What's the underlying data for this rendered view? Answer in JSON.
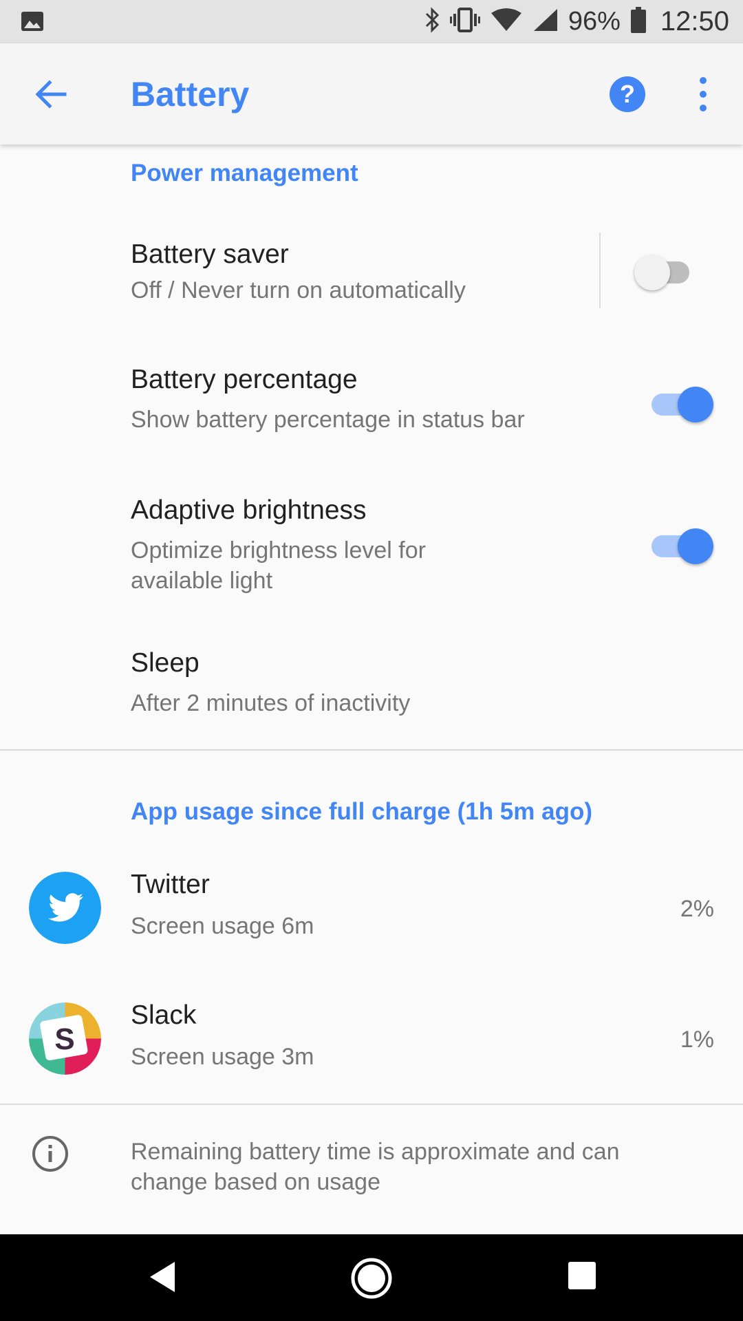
{
  "status_bar": {
    "battery_text": "96%",
    "time": "12:50",
    "icons": [
      "image-icon",
      "bluetooth-icon",
      "vibrate-icon",
      "wifi-icon",
      "signal-icon",
      "battery-icon"
    ]
  },
  "app_bar": {
    "title": "Battery",
    "icons": [
      "back-arrow-icon",
      "help-icon",
      "more-vert-icon"
    ]
  },
  "power_management": {
    "header": "Power management",
    "items": [
      {
        "title": "Battery saver",
        "subtitle": "Off / Never turn on automatically",
        "toggle": "off"
      },
      {
        "title": "Battery percentage",
        "subtitle": "Show battery percentage in status bar",
        "toggle": "on"
      },
      {
        "title": "Adaptive brightness",
        "subtitle": "Optimize brightness level for available light",
        "toggle": "on"
      },
      {
        "title": "Sleep",
        "subtitle": "After 2 minutes of inactivity"
      }
    ]
  },
  "app_usage": {
    "header": "App usage since full charge (1h 5m ago)",
    "apps": [
      {
        "name": "Twitter",
        "detail": "Screen usage 6m",
        "percent": "2%",
        "icon": "twitter-icon"
      },
      {
        "name": "Slack",
        "detail": "Screen usage 3m",
        "percent": "1%",
        "icon": "slack-icon"
      }
    ]
  },
  "footer": {
    "info_text": "Remaining battery time is approximate and can change based on usage",
    "icon": "info-icon"
  },
  "nav_bar": {
    "icons": [
      "nav-back-icon",
      "nav-home-icon",
      "nav-recents-icon"
    ]
  },
  "colors": {
    "accent": "#4285f4",
    "twitter": "#1da1f2",
    "status_bar_bg": "#e3e3e3",
    "background": "#fafafa"
  }
}
